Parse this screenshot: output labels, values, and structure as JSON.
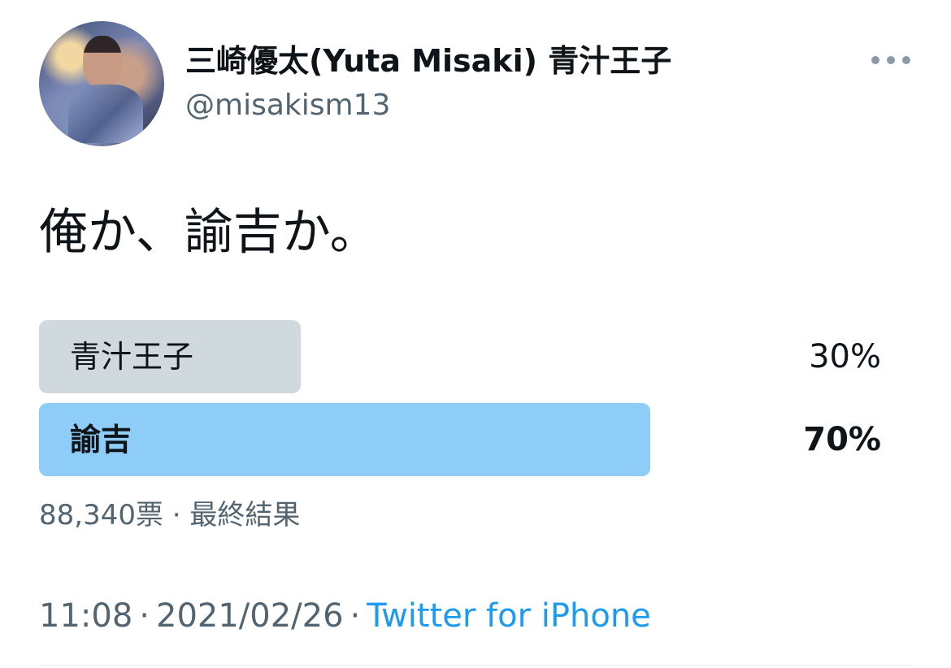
{
  "tweet": {
    "author": {
      "display_name": "三崎優太(Yuta Misaki) 青汁王子",
      "handle": "@misakism13",
      "avatar_icon": "avatar-image"
    },
    "more_icon": "more-horizontal-icon",
    "text": "俺か、諭吉か。"
  },
  "poll": {
    "options": [
      {
        "label": "青汁王子",
        "percent_text": "30%",
        "percent": 30,
        "bar_color": "#cfd9de"
      },
      {
        "label": "諭吉",
        "percent_text": "70%",
        "percent": 70,
        "bar_color": "#8ecdf8"
      }
    ],
    "meta": "88,340票 · 最終結果"
  },
  "footer": {
    "time": "11:08",
    "date": "2021/02/26",
    "separator": "·",
    "source": "Twitter for iPhone"
  }
}
